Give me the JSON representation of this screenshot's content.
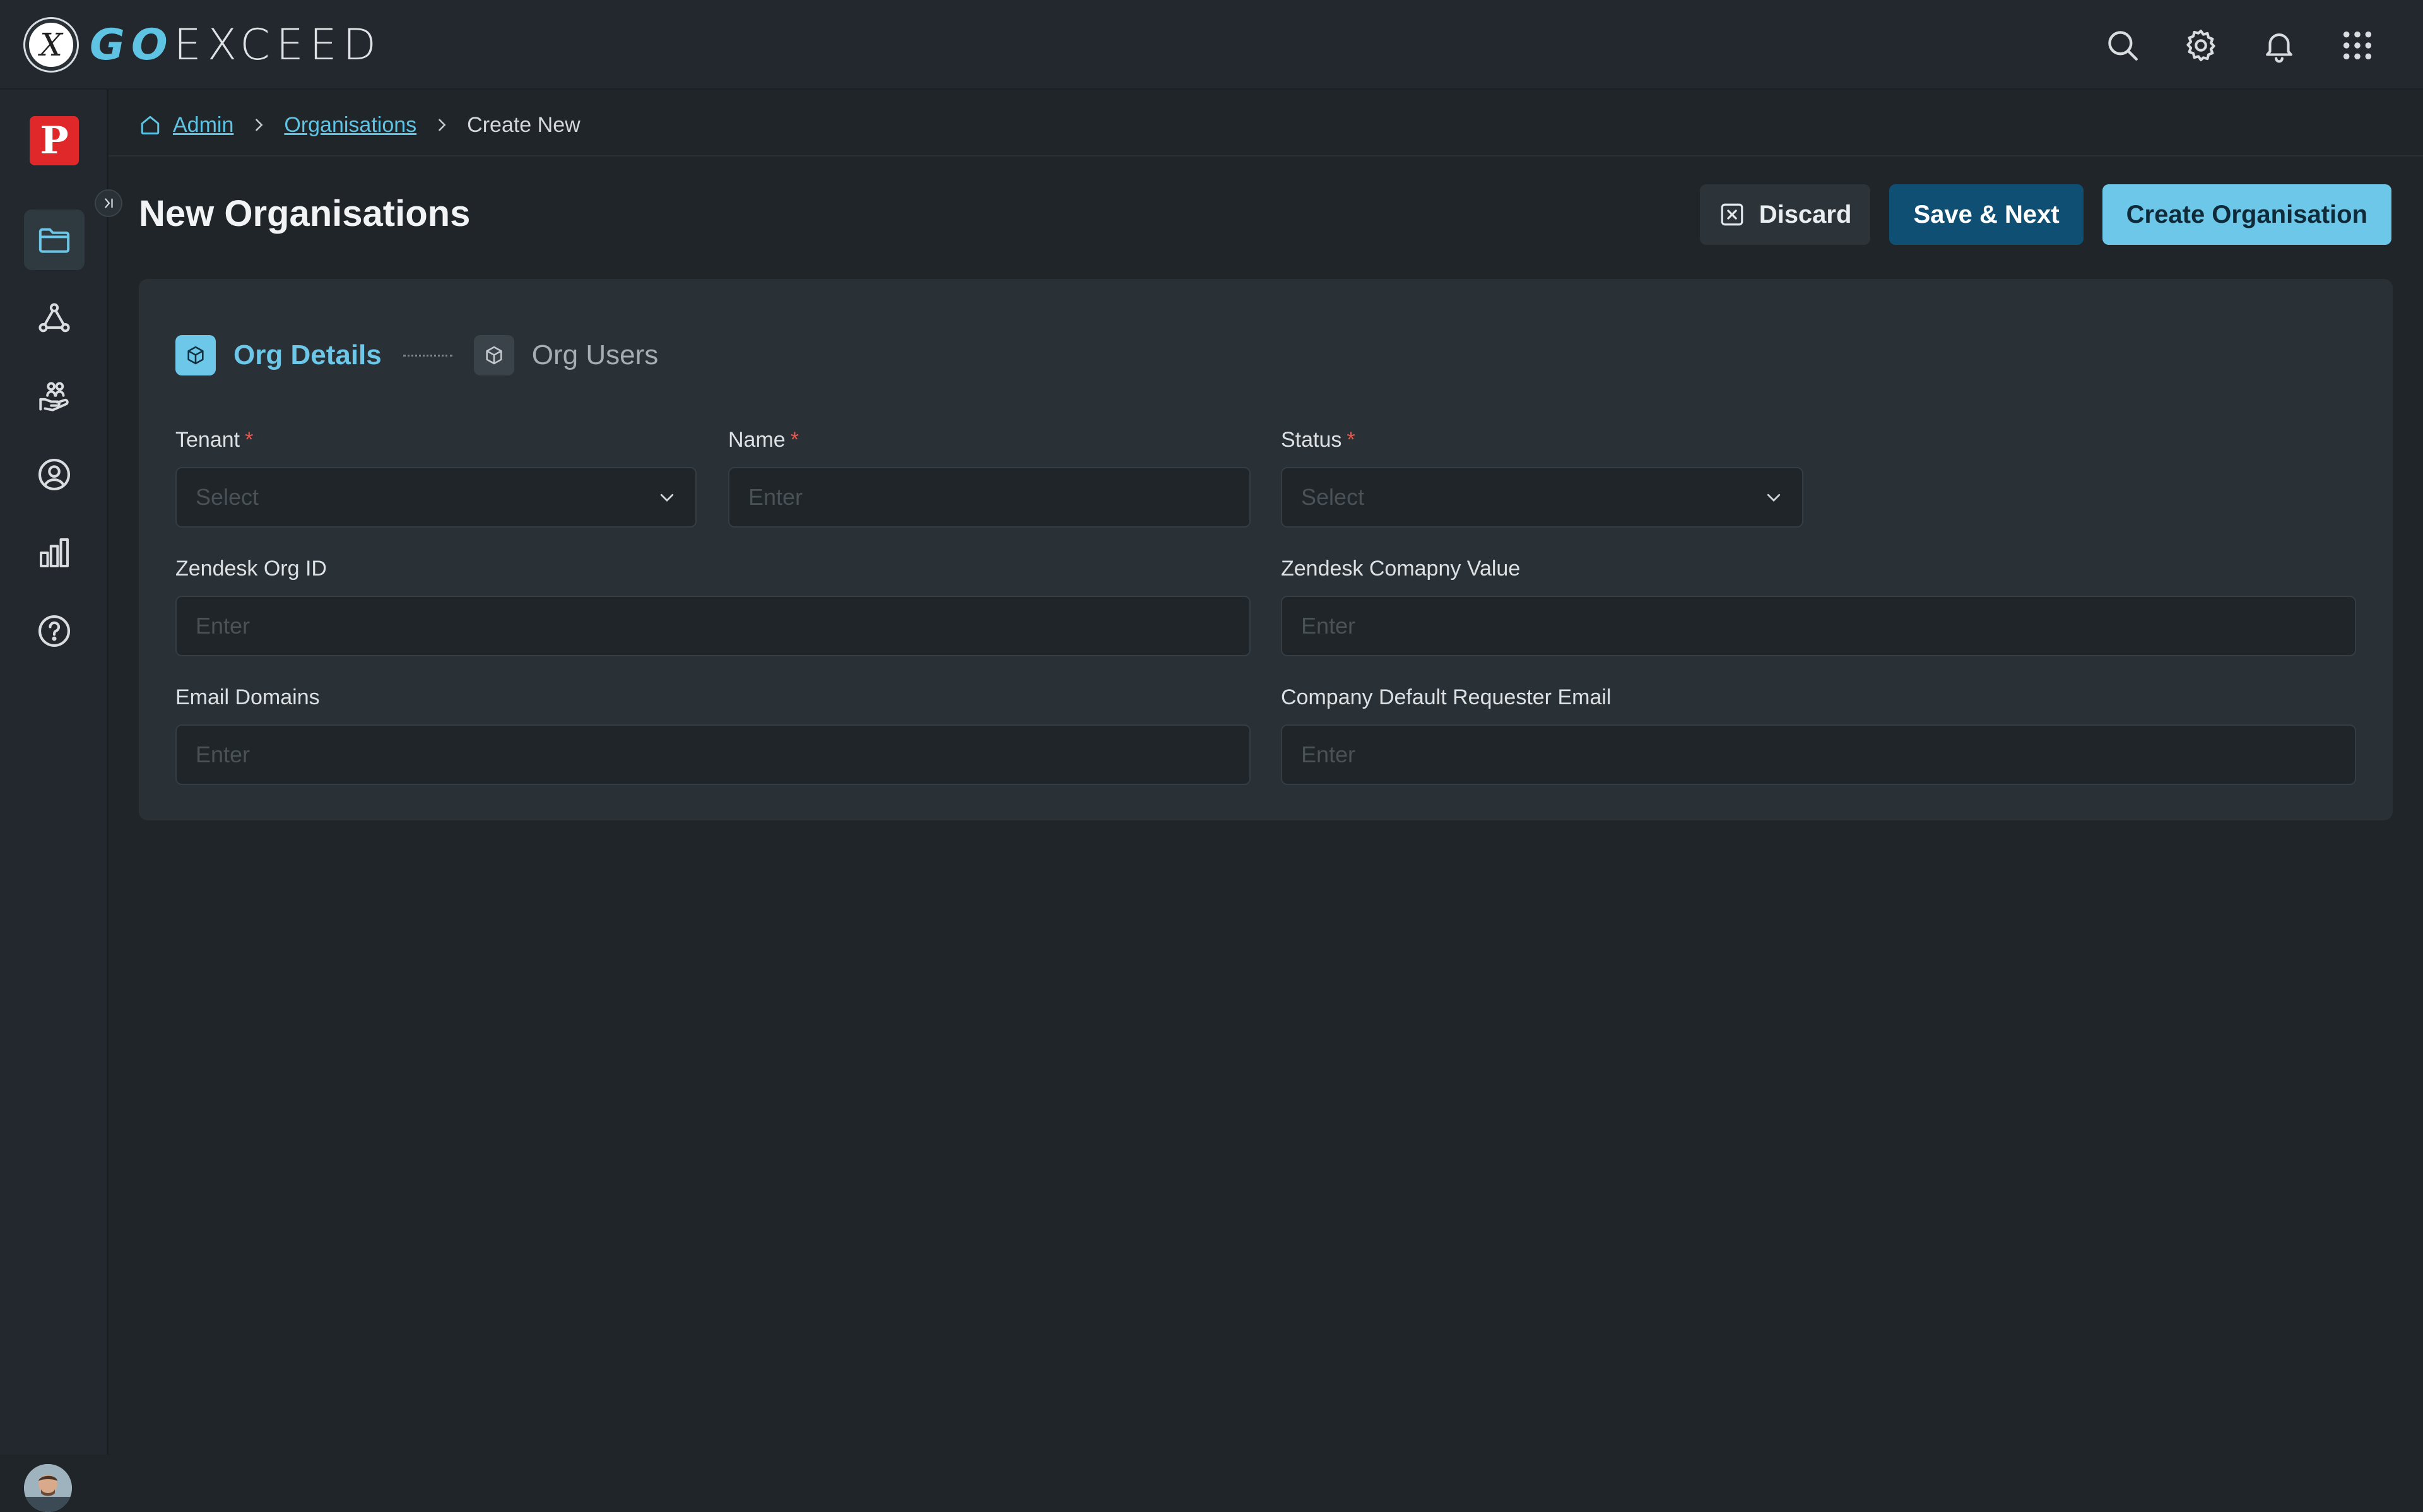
{
  "app": {
    "logo_text_accent": "GO",
    "logo_text_rest": "EXCEED",
    "logo_glyph": "X"
  },
  "topbar": {
    "icons": [
      "search-icon",
      "settings-gear-icon",
      "notification-bell-icon",
      "apps-grid-icon"
    ]
  },
  "sidebar": {
    "brand_letter": "P",
    "items": [
      {
        "name": "folder-icon",
        "active": true
      },
      {
        "name": "network-nodes-icon",
        "active": false
      },
      {
        "name": "hand-people-icon",
        "active": false
      },
      {
        "name": "user-circle-icon",
        "active": false
      },
      {
        "name": "bar-chart-icon",
        "active": false
      },
      {
        "name": "help-circle-icon",
        "active": false
      }
    ],
    "collapse_glyph": ">|"
  },
  "breadcrumb": {
    "items": [
      "Admin",
      "Organisations",
      "Create New"
    ]
  },
  "header": {
    "title": "New Organisations",
    "discard_label": "Discard",
    "save_next_label": "Save & Next",
    "create_label": "Create Organisation"
  },
  "steps": [
    {
      "label": "Org Details",
      "active": true
    },
    {
      "label": "Org Users",
      "active": false
    }
  ],
  "form": {
    "tenant": {
      "label": "Tenant",
      "required_mark": "*",
      "placeholder": "Select"
    },
    "name": {
      "label": "Name",
      "required_mark": "*",
      "placeholder": "Enter"
    },
    "status": {
      "label": "Status",
      "required_mark": "*",
      "placeholder": "Select"
    },
    "zendesk_org_id": {
      "label": "Zendesk Org ID",
      "placeholder": "Enter"
    },
    "zendesk_company_value": {
      "label": "Zendesk Comapny Value",
      "placeholder": "Enter"
    },
    "email_domains": {
      "label": "Email Domains",
      "placeholder": "Enter"
    },
    "company_default_requester_email": {
      "label": "Company Default Requester Email",
      "placeholder": "Enter"
    }
  },
  "colors": {
    "accent": "#6cc7e8",
    "primary_dark": "#0f4f74",
    "brand_red": "#e0282b",
    "background": "#1f2529",
    "card": "#293036"
  }
}
